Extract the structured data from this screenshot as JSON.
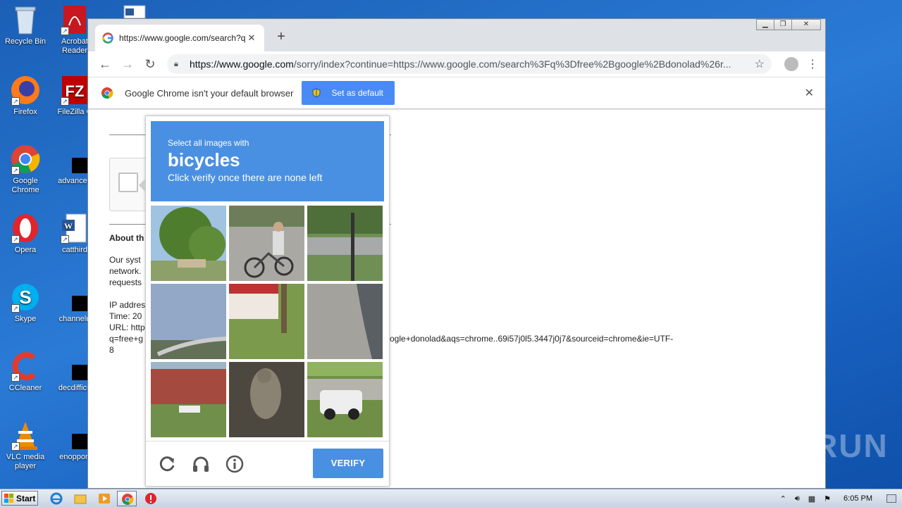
{
  "desktop": {
    "icons_left": [
      {
        "label": "Recycle Bin",
        "icon": "recycle-bin-icon"
      },
      {
        "label": "Firefox",
        "icon": "firefox-icon"
      },
      {
        "label": "Google Chrome",
        "icon": "chrome-icon"
      },
      {
        "label": "Opera",
        "icon": "opera-icon"
      },
      {
        "label": "Skype",
        "icon": "skype-icon"
      },
      {
        "label": "CCleaner",
        "icon": "ccleaner-icon"
      },
      {
        "label": "VLC media player",
        "icon": "vlc-icon"
      }
    ],
    "icons_right": [
      {
        "label": "Acrobat Reader",
        "icon": "acrobat-icon"
      },
      {
        "label": "FileZilla C",
        "icon": "filezilla-icon"
      },
      {
        "label": "advanced",
        "icon": "file-icon"
      },
      {
        "label": "catthird",
        "icon": "word-doc-icon"
      },
      {
        "label": "channelri",
        "icon": "file-icon"
      },
      {
        "label": "decdifficu",
        "icon": "file-icon"
      },
      {
        "label": "enopport",
        "icon": "file-icon"
      }
    ]
  },
  "browser": {
    "tab_title": "https://www.google.com/search?q=",
    "url_host": "https://www.google.com",
    "url_rest": "/sorry/index?continue=https://www.google.com/search%3Fq%3Dfree%2Bgoogle%2Bdonolad%26r...",
    "infobar_message": "Google Chrome isn't your default browser",
    "set_default_label": "Set as default"
  },
  "page": {
    "about_heading": "About th",
    "line1": "Our syst",
    "line2": "network.",
    "line3": "requests",
    "ip_line": "IP addres",
    "time_line": "Time: 20",
    "url_line": "URL: http",
    "q_line": "q=free+g",
    "tail_line": "ogle+donolad&aqs=chrome..69i57j0l5.3447j0j7&sourceid=chrome&ie=UTF-",
    "eight": "8"
  },
  "captcha": {
    "instruction": "Select all images with",
    "target": "bicycles",
    "subtext": "Click verify once there are none left",
    "verify_label": "VERIFY"
  },
  "taskbar": {
    "start_label": "Start",
    "clock": "6:05 PM"
  },
  "watermark": "ANY RUN"
}
